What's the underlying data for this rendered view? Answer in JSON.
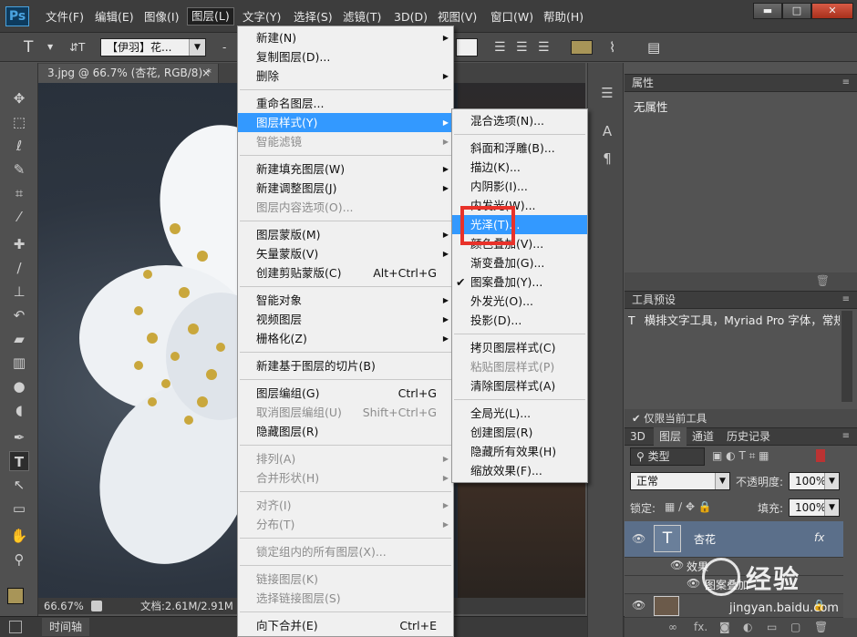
{
  "app": {
    "logo": "Ps"
  },
  "menubar": [
    "文件(F)",
    "编辑(E)",
    "图像(I)",
    "图层(L)",
    "文字(Y)",
    "选择(S)",
    "滤镜(T)",
    "3D(D)",
    "视图(V)",
    "窗口(W)",
    "帮助(H)"
  ],
  "window_controls": {
    "minimize": "▬",
    "maximize": "□",
    "close": "✕"
  },
  "options": {
    "tool_glyph": "T",
    "orient_glyph": "⇵T",
    "font_name": "【伊羽】花...",
    "dash": "-"
  },
  "document": {
    "tab_label": "3.jpg @ 66.7% (杏花, RGB/8) *",
    "close_glyph": "×"
  },
  "status": {
    "zoom": "66.67%",
    "doc_info": "文档:2.61M/2.91M"
  },
  "timeline": {
    "label": "时间轴"
  },
  "panels": {
    "properties": {
      "title": "属性",
      "content": "无属性"
    },
    "tool_presets": {
      "title": "工具预设",
      "row": "横排文字工具，Myriad Pro 字体，常规",
      "checkbox_label": "仅限当前工具"
    },
    "layers": {
      "tabs": [
        "3D",
        "图层",
        "通道",
        "历史记录"
      ],
      "filter_kind": "类型",
      "blend_mode": "正常",
      "opacity_label": "不透明度:",
      "opacity_value": "100%",
      "lock_label": "锁定:",
      "fill_label": "填充:",
      "fill_value": "100%",
      "layer_name": "杏花",
      "fx_badge": "fx",
      "effects_label": "效果",
      "effect_item": "图案叠加"
    }
  },
  "layer_menu": [
    {
      "label": "新建(N)",
      "sub": true
    },
    {
      "label": "复制图层(D)..."
    },
    {
      "label": "删除",
      "sub": true
    },
    {
      "sep": true
    },
    {
      "label": "重命名图层..."
    },
    {
      "label": "图层样式(Y)",
      "sub": true,
      "hl": true
    },
    {
      "label": "智能滤镜",
      "sub": true,
      "dis": true
    },
    {
      "sep": true
    },
    {
      "label": "新建填充图层(W)",
      "sub": true
    },
    {
      "label": "新建调整图层(J)",
      "sub": true
    },
    {
      "label": "图层内容选项(O)...",
      "dis": true
    },
    {
      "sep": true
    },
    {
      "label": "图层蒙版(M)",
      "sub": true
    },
    {
      "label": "矢量蒙版(V)",
      "sub": true
    },
    {
      "label": "创建剪贴蒙版(C)",
      "sc": "Alt+Ctrl+G"
    },
    {
      "sep": true
    },
    {
      "label": "智能对象",
      "sub": true
    },
    {
      "label": "视频图层",
      "sub": true
    },
    {
      "label": "栅格化(Z)",
      "sub": true
    },
    {
      "sep": true
    },
    {
      "label": "新建基于图层的切片(B)"
    },
    {
      "sep": true
    },
    {
      "label": "图层编组(G)",
      "sc": "Ctrl+G"
    },
    {
      "label": "取消图层编组(U)",
      "sc": "Shift+Ctrl+G",
      "dis": true
    },
    {
      "label": "隐藏图层(R)"
    },
    {
      "sep": true
    },
    {
      "label": "排列(A)",
      "sub": true,
      "dis": true
    },
    {
      "label": "合并形状(H)",
      "sub": true,
      "dis": true
    },
    {
      "sep": true
    },
    {
      "label": "对齐(I)",
      "sub": true,
      "dis": true
    },
    {
      "label": "分布(T)",
      "sub": true,
      "dis": true
    },
    {
      "sep": true
    },
    {
      "label": "锁定组内的所有图层(X)...",
      "dis": true
    },
    {
      "sep": true
    },
    {
      "label": "链接图层(K)",
      "dis": true
    },
    {
      "label": "选择链接图层(S)",
      "dis": true
    },
    {
      "sep": true
    },
    {
      "label": "向下合并(E)",
      "sc": "Ctrl+E"
    }
  ],
  "style_menu": [
    {
      "label": "混合选项(N)..."
    },
    {
      "sep": true
    },
    {
      "label": "斜面和浮雕(B)..."
    },
    {
      "label": "描边(K)..."
    },
    {
      "label": "内阴影(I)..."
    },
    {
      "label": "内发光(W)..."
    },
    {
      "label": "光泽(T)...",
      "hl": true
    },
    {
      "label": "颜色叠加(V)..."
    },
    {
      "label": "渐变叠加(G)..."
    },
    {
      "label": "图案叠加(Y)...",
      "checked": true
    },
    {
      "label": "外发光(O)..."
    },
    {
      "label": "投影(D)..."
    },
    {
      "sep": true
    },
    {
      "label": "拷贝图层样式(C)"
    },
    {
      "label": "粘贴图层样式(P)",
      "dis": true
    },
    {
      "label": "清除图层样式(A)"
    },
    {
      "sep": true
    },
    {
      "label": "全局光(L)..."
    },
    {
      "label": "创建图层(R)"
    },
    {
      "label": "隐藏所有效果(H)"
    },
    {
      "label": "缩放效果(F)..."
    }
  ],
  "watermark": {
    "brand": "经验",
    "url": "jingyan.baidu.com"
  }
}
